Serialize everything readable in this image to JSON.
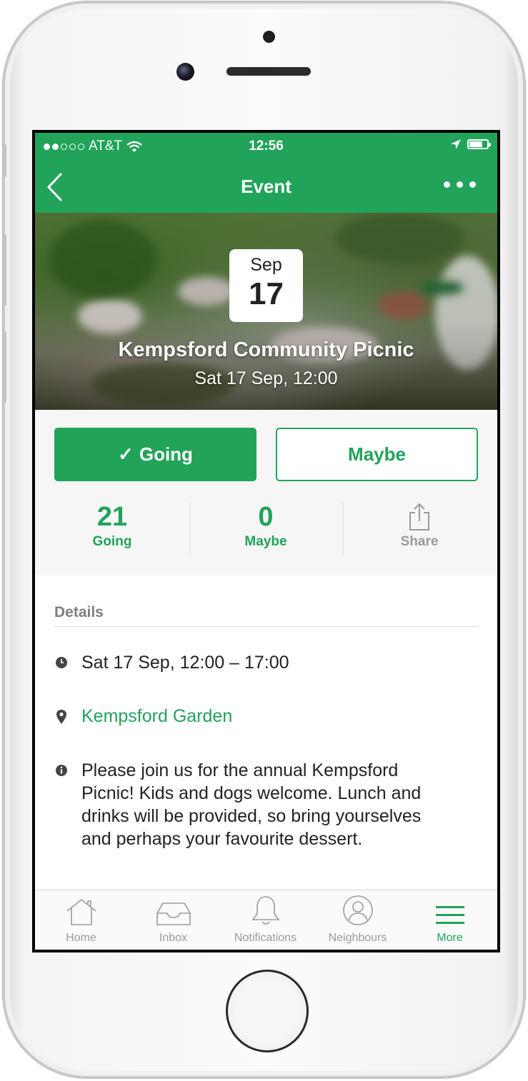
{
  "status_bar": {
    "carrier": "AT&T",
    "time": "12:56",
    "signal_bars_filled": 2,
    "signal_bars_total": 5
  },
  "nav": {
    "title": "Event",
    "back_icon": "chevron-left-icon",
    "more_icon": "more-dots-icon"
  },
  "event": {
    "month": "Sep",
    "day": "17",
    "title": "Kempsford Community Picnic",
    "datetime": "Sat 17 Sep, 12:00"
  },
  "rsvp": {
    "going_check": "✓",
    "going_label": "Going",
    "maybe_label": "Maybe"
  },
  "stats": {
    "going_count": "21",
    "going_label": "Going",
    "maybe_count": "0",
    "maybe_label": "Maybe",
    "share_label": "Share"
  },
  "details": {
    "heading": "Details",
    "time_range": "Sat 17 Sep, 12:00 – 17:00",
    "location": "Kempsford Garden",
    "description": "Please join us for the annual Kempsford Picnic! Kids and dogs welcome. Lunch and drinks will be provided, so bring yourselves and perhaps your favourite dessert."
  },
  "tabs": [
    {
      "label": "Home",
      "icon": "home-icon"
    },
    {
      "label": "Inbox",
      "icon": "inbox-icon"
    },
    {
      "label": "Notifications",
      "icon": "bell-icon"
    },
    {
      "label": "Neighbours",
      "icon": "person-icon"
    },
    {
      "label": "More",
      "icon": "menu-icon",
      "active": true
    }
  ],
  "colors": {
    "accent": "#21a35a",
    "muted_text": "#9b9b9b",
    "body_text": "#222222"
  }
}
